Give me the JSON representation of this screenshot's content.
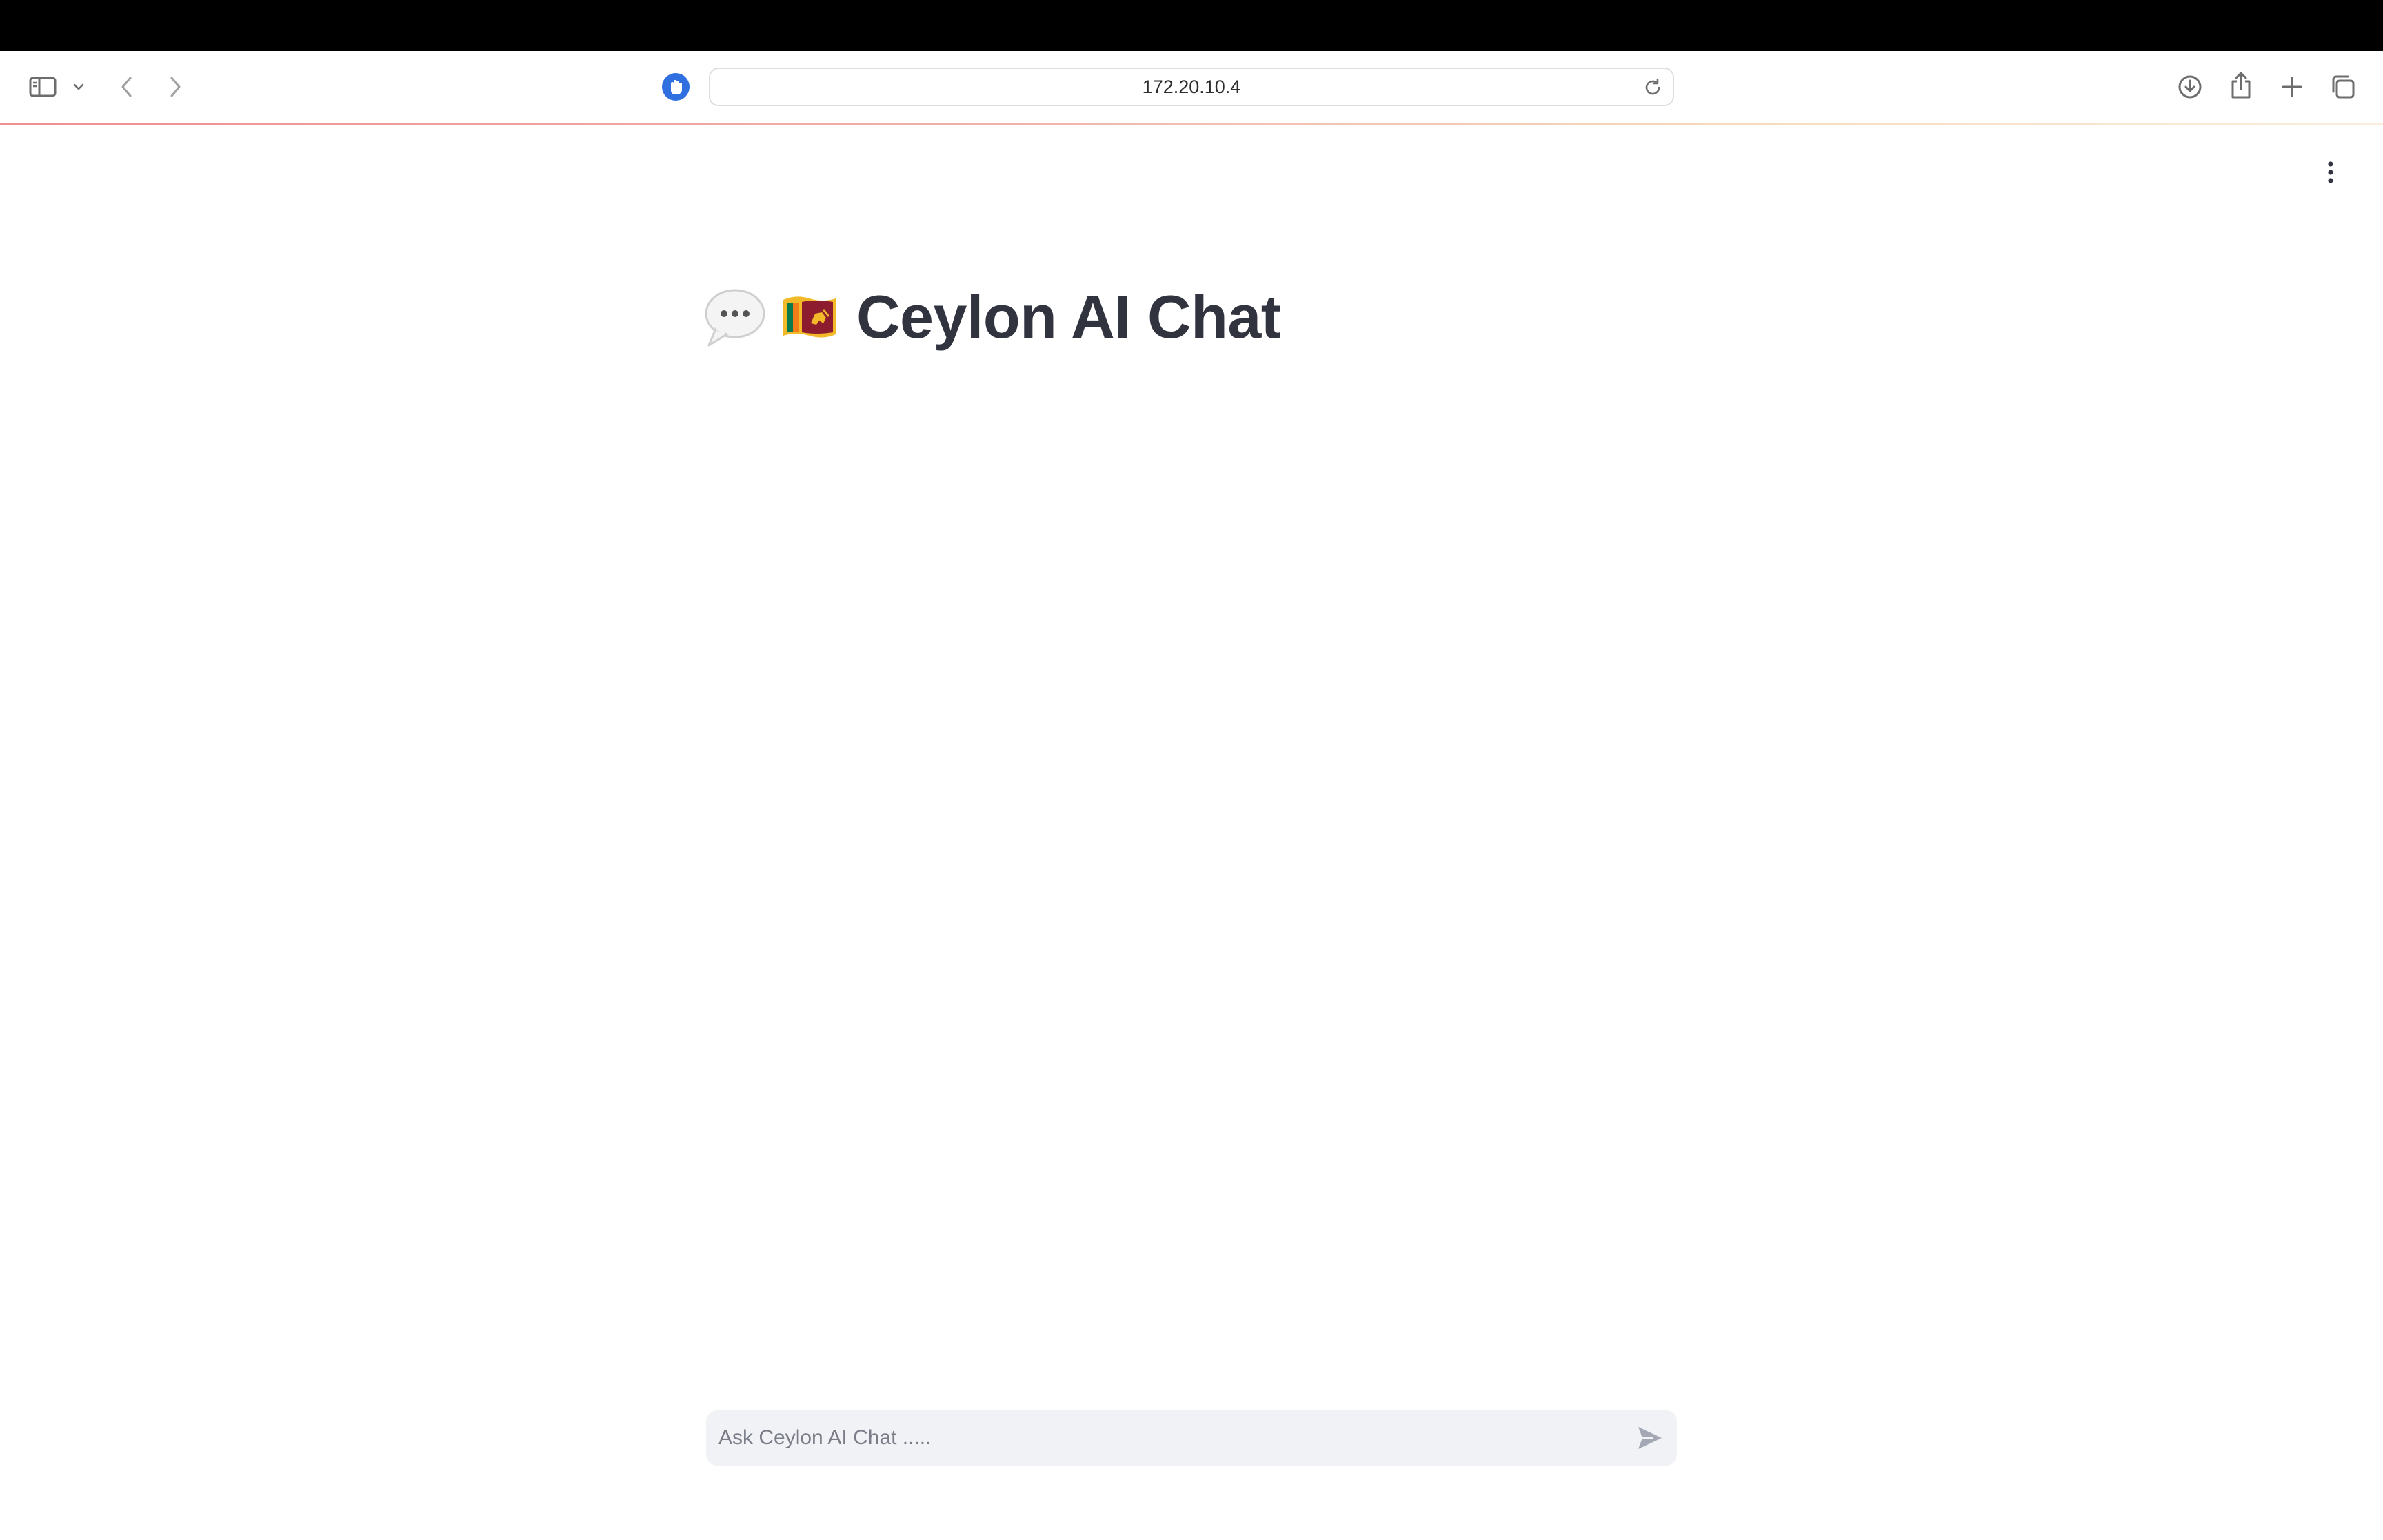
{
  "browser": {
    "url": "172.20.10.4",
    "icons": {
      "sidebar": "sidebar-toggle-icon",
      "chevron": "chevron-down-icon",
      "back": "back-arrow-icon",
      "forward": "forward-arrow-icon",
      "shield": "privacy-shield-icon",
      "reload": "reload-icon",
      "download": "download-icon",
      "share": "share-icon",
      "new_tab": "plus-icon",
      "tabs": "tab-overview-icon"
    }
  },
  "app": {
    "title": "Ceylon AI Chat",
    "title_icons": [
      "speech-bubble-icon",
      "sri-lanka-flag-icon"
    ],
    "menu_icon": "kebab-menu-icon",
    "chat_input": {
      "placeholder": "Ask Ceylon AI Chat .....",
      "value": ""
    },
    "send_icon": "send-icon"
  },
  "colors": {
    "title": "#31333f",
    "input_bg": "#f0f2f6",
    "shield": "#2f6fe0",
    "accent_line_start": "#ef8f8f"
  }
}
